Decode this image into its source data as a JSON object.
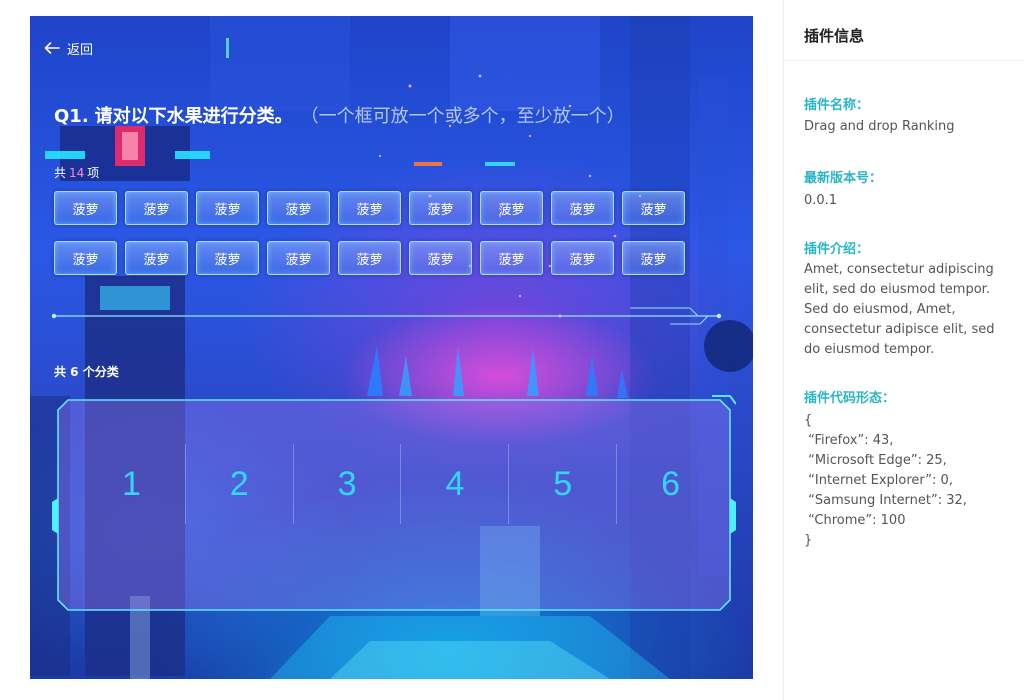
{
  "stage": {
    "back_label": "返回",
    "question": {
      "number": "Q1.",
      "text": "请对以下水果进行分类。",
      "hint": "（一个框可放一个或多个，至少放一个）"
    },
    "items_count": {
      "prefix": "共",
      "count": "14",
      "suffix": "项"
    },
    "items": [
      "菠萝",
      "菠萝",
      "菠萝",
      "菠萝",
      "菠萝",
      "菠萝",
      "菠萝",
      "菠萝",
      "菠萝",
      "菠萝",
      "菠萝",
      "菠萝",
      "菠萝",
      "菠萝",
      "菠萝",
      "菠萝",
      "菠萝",
      "菠萝"
    ],
    "categories_count_label": "共 6 个分类",
    "categories": [
      "1",
      "2",
      "3",
      "4",
      "5",
      "6"
    ]
  },
  "panel": {
    "title": "插件信息",
    "name_label": "插件名称：",
    "name_value": "Drag and drop Ranking",
    "version_label": "最新版本号：",
    "version_value": "0.0.1",
    "intro_label": "插件介绍：",
    "intro_value": "Amet, consectetur adipiscing elit, sed do eiusmod tempor. Sed do eiusmod, Amet, consectetur adipisce elit, sed do eiusmod tempor.",
    "code_label": "插件代码形态：",
    "code_value": "{\n “Firefox”: 43,\n “Microsoft Edge”: 25,\n “Internet Explorer”: 0,\n “Samsung Internet”: 32,\n “Chrome”: 100\n}"
  },
  "colors": {
    "accent": "#2cb5c5",
    "slot_number": "#33d6ff",
    "count_highlight": "#ff8ad8",
    "stage_base": "#2a58e6"
  },
  "icons": {
    "back": "arrow-left-icon"
  }
}
